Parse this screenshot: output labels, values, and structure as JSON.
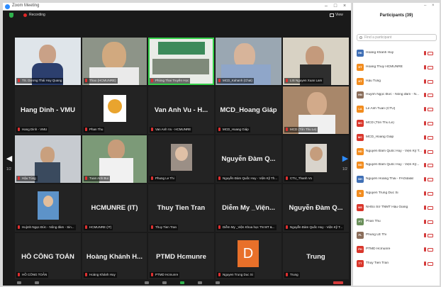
{
  "window": {
    "title": "Zoom Meeting"
  },
  "topbar": {
    "recording": "Recording",
    "view": "View"
  },
  "tiles": [
    {
      "name": "TS. Dương Thái Huy Quang"
    },
    {
      "name": "Thao (HCMUNRE)"
    },
    {
      "name": "Phòng Thai Truyền Học"
    },
    {
      "name": "MCD_Kahanh (Chat)"
    },
    {
      "name": "LIS Nguyen Xuan Lam"
    },
    {
      "big": "Hang Dinh - VMU",
      "name": "Hang Dinh - VMU"
    },
    {
      "name": "Phan Thu"
    },
    {
      "big": "Van Anh Vu - H...",
      "name": "Van Anh Vu - HCMUNRE"
    },
    {
      "big": "MCD_Hoang Giáp",
      "name": "MCD_Hoang Giáp"
    },
    {
      "name": "MCD (Tôn Thu Le)"
    },
    {
      "name": "Hậu Tùng"
    },
    {
      "name": "Tuan Anh Bui"
    },
    {
      "name": "Phung Le Thi"
    },
    {
      "big": "Nguyễn Đàm Q...",
      "name": "Nguyễn Đàm Quốc Huy - Viện Kỹ Th..."
    },
    {
      "name": "CTU_Thanh Vo"
    },
    {
      "name": "Huỳnh Ngọc Đức - Nông đàm - Sin..."
    },
    {
      "big": "HCMUNRE (IT)",
      "name": "HCMUNRE (IT)"
    },
    {
      "big": "Thuy Tien Tran",
      "name": "Thuy Tien Tran"
    },
    {
      "big": "Diễm My _Viện...",
      "name": "Diễm My _Viện Khoa học TN MT &..."
    },
    {
      "big": "Nguyễn Đàm Q...",
      "name": "Nguyễn Đàm Quốc Huy - Viện Kỹ T..."
    },
    {
      "big": "HỒ CÔNG TOẢN",
      "name": "HỒ CÔNG TOẢN"
    },
    {
      "big": "Hoàng Khánh H...",
      "name": "Hoàng Khánh Huy"
    },
    {
      "big": "PTMD Hcmunre",
      "name": "PTMD Hcmunre"
    },
    {
      "big": "D",
      "name": "Nguyen Trung Duc Si"
    },
    {
      "big": "Trung",
      "name": "Trung"
    }
  ],
  "pager": {
    "left": "1/2",
    "right": "1/2"
  },
  "participants": {
    "title": "Participants (39)",
    "search_placeholder": "Find a participant",
    "items": [
      {
        "initials": "HK",
        "color": "#3f6fb5",
        "name": "Hoàng Khánh Huy"
      },
      {
        "initials": "HT",
        "color": "#f28c1e",
        "name": "Hoang Thuy HCMUNRE"
      },
      {
        "initials": "HT",
        "color": "#f28c1e",
        "name": "Hậu Tùng"
      },
      {
        "initials": "HN",
        "color": "#8a6d5a",
        "name": "Huỳnh Ngọc Đức - Nông đàm - N..."
      },
      {
        "initials": "LA",
        "color": "#f28c1e",
        "name": "Le Anh Tuan (CTU)"
      },
      {
        "initials": "MC",
        "color": "#d9362b",
        "name": "MCD (Tôn Thu Le)"
      },
      {
        "initials": "MC",
        "color": "#d9362b",
        "name": "MCD_Hoang Giáp"
      },
      {
        "initials": "ND",
        "color": "#f28c1e",
        "name": "Nguyễn Đàm Quốc Huy - Viện Kỹ T..."
      },
      {
        "initials": "ND",
        "color": "#f28c1e",
        "name": "Nguyễn Đàm Quốc Huy - Viện Kỹ..."
      },
      {
        "initials": "NH",
        "color": "#3f6fb5",
        "name": "Nguyễn Hoàng Thái - FAOdalat"
      },
      {
        "initials": "N",
        "color": "#f28c1e",
        "name": "Nguyen Trung Duc Si"
      },
      {
        "initials": "NS",
        "color": "#d9362b",
        "name": "NHSo Sở TNMT Hậu Giang"
      },
      {
        "initials": "PT",
        "color": "#6a8f5a",
        "name": "Phan Thu"
      },
      {
        "initials": "PL",
        "color": "#8a6d5a",
        "name": "Phung LE Thi"
      },
      {
        "initials": "PH",
        "color": "#d9362b",
        "name": "PTMD Hcmunre"
      },
      {
        "initials": "TT",
        "color": "#d9362b",
        "name": "Thuy Tien Tran"
      }
    ]
  }
}
